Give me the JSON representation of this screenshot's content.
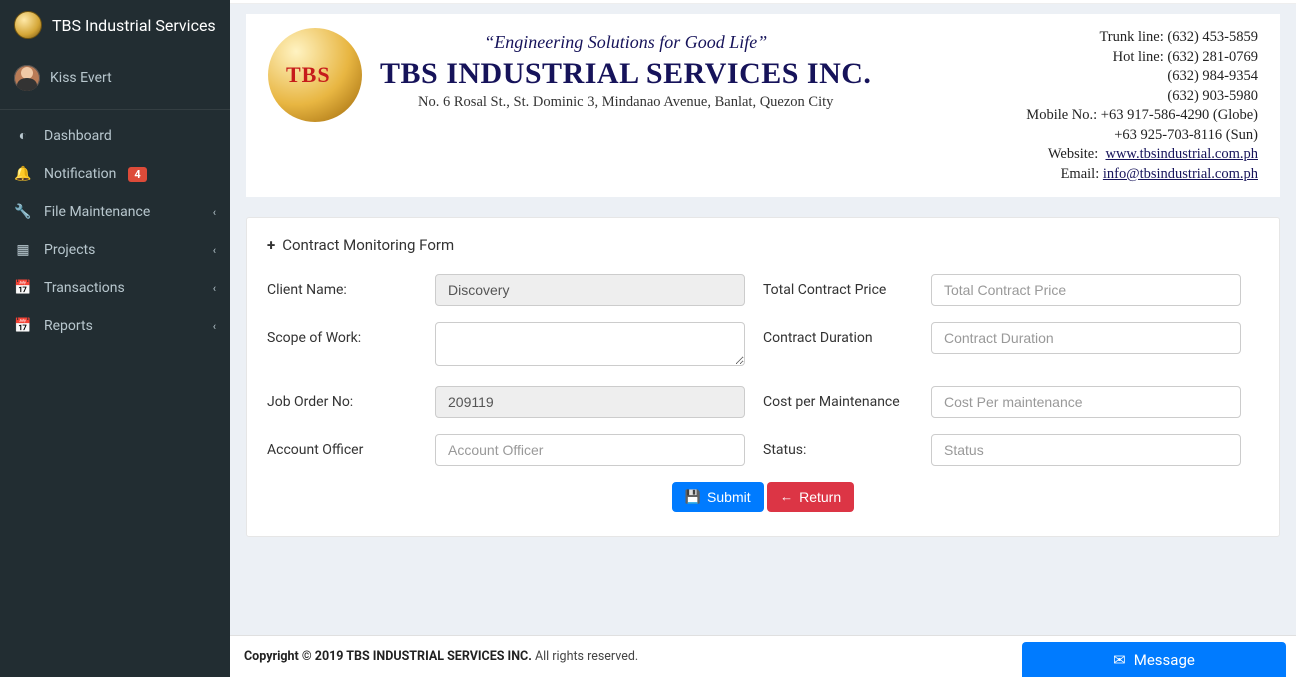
{
  "brand": {
    "title": "TBS Industrial Services"
  },
  "user": {
    "name": "Kiss Evert"
  },
  "nav": {
    "dashboard": "Dashboard",
    "notification": "Notification",
    "notification_badge": "4",
    "file_maintenance": "File Maintenance",
    "projects": "Projects",
    "transactions": "Transactions",
    "reports": "Reports"
  },
  "banner": {
    "logo_text": "TBS",
    "tagline": "“Engineering Solutions for Good Life”",
    "company": "TBS INDUSTRIAL SERVICES INC.",
    "address": "No. 6 Rosal St., St. Dominic 3, Mindanao Avenue, Banlat, Quezon City",
    "contact": {
      "trunk": "Trunk line: (632) 453-5859",
      "hot": "Hot line: (632) 281-0769",
      "line3": "(632) 984-9354",
      "line4": "(632)  903-5980",
      "mobile": "Mobile No.: +63 917-586-4290 (Globe)",
      "mobile2": "+63 925-703-8116 (Sun)",
      "website_label": "Website:",
      "website": "www.tbsindustrial.com.ph",
      "email_label": "Email:",
      "email": "info@tbsindustrial.com.ph"
    }
  },
  "panel": {
    "title": "Contract Monitoring Form"
  },
  "form": {
    "client_name": {
      "label": "Client Name:",
      "value": "Discovery"
    },
    "scope": {
      "label": "Scope of Work:",
      "value": ""
    },
    "job_order": {
      "label": "Job Order No:",
      "value": "209119"
    },
    "account_officer": {
      "label": "Account Officer",
      "placeholder": "Account Officer"
    },
    "total_price": {
      "label": "Total Contract Price",
      "placeholder": "Total Contract Price"
    },
    "duration": {
      "label": "Contract Duration",
      "placeholder": "Contract Duration"
    },
    "cost_maint": {
      "label": "Cost per Maintenance",
      "placeholder": "Cost Per maintenance"
    },
    "status": {
      "label": "Status:",
      "placeholder": "Status"
    }
  },
  "buttons": {
    "submit": "Submit",
    "return": "Return",
    "message": "Message"
  },
  "footer": {
    "copyright": "Copyright © 2019 TBS INDUSTRIAL SERVICES INC.",
    "rights": " All rights reserved."
  }
}
